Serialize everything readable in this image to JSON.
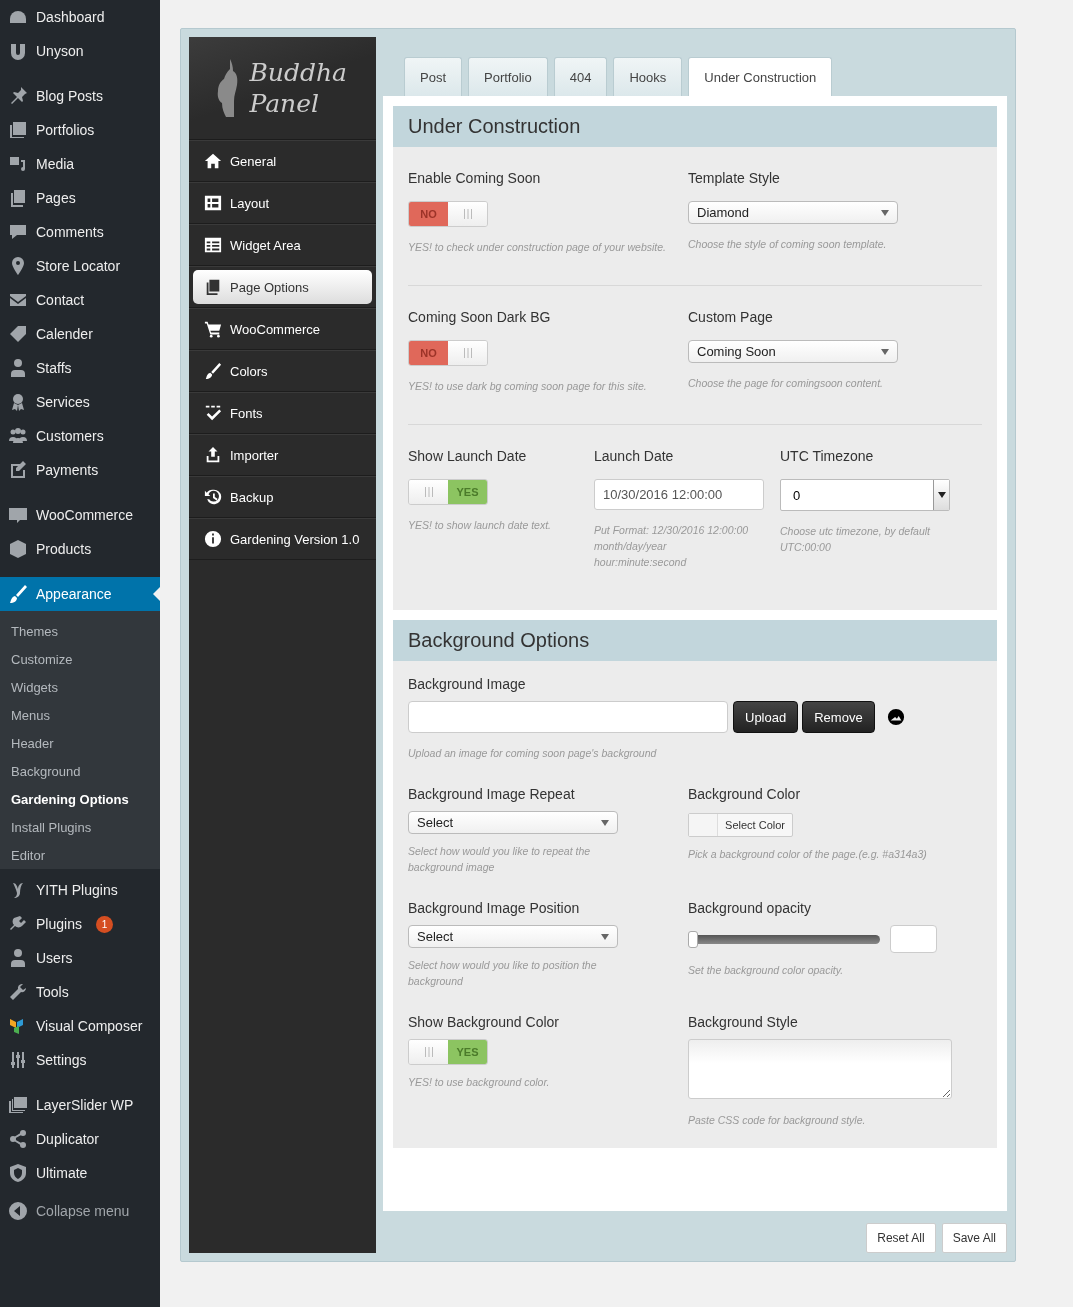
{
  "admin_menu": {
    "groups": [
      [
        {
          "label": "Dashboard",
          "selected": false
        },
        {
          "label": "Unyson",
          "selected": false
        }
      ],
      [
        {
          "label": "Blog Posts",
          "selected": false
        },
        {
          "label": "Portfolios",
          "selected": false
        },
        {
          "label": "Media",
          "selected": false
        },
        {
          "label": "Pages",
          "selected": false
        },
        {
          "label": "Comments",
          "selected": false
        },
        {
          "label": "Store Locator",
          "selected": false
        },
        {
          "label": "Contact",
          "selected": false
        },
        {
          "label": "Calender",
          "selected": false
        },
        {
          "label": "Staffs",
          "selected": false
        },
        {
          "label": "Services",
          "selected": false
        },
        {
          "label": "Customers",
          "selected": false
        },
        {
          "label": "Payments",
          "selected": false
        }
      ],
      [
        {
          "label": "WooCommerce",
          "selected": false
        },
        {
          "label": "Products",
          "selected": false
        }
      ],
      [
        {
          "label": "Appearance",
          "selected": true,
          "children": [
            {
              "label": "Themes",
              "selected": false
            },
            {
              "label": "Customize",
              "selected": false
            },
            {
              "label": "Widgets",
              "selected": false
            },
            {
              "label": "Menus",
              "selected": false
            },
            {
              "label": "Header",
              "selected": false
            },
            {
              "label": "Background",
              "selected": false
            },
            {
              "label": "Gardening Options",
              "selected": true
            },
            {
              "label": "Install Plugins",
              "selected": false
            },
            {
              "label": "Editor",
              "selected": false
            }
          ]
        }
      ],
      [
        {
          "label": "YITH Plugins",
          "selected": false
        },
        {
          "label": "Plugins",
          "selected": false,
          "badge": "1"
        },
        {
          "label": "Users",
          "selected": false
        },
        {
          "label": "Tools",
          "selected": false
        },
        {
          "label": "Visual Composer",
          "selected": false
        },
        {
          "label": "Settings",
          "selected": false
        }
      ],
      [
        {
          "label": "LayerSlider WP",
          "selected": false
        },
        {
          "label": "Duplicator",
          "selected": false
        },
        {
          "label": "Ultimate",
          "selected": false
        }
      ]
    ],
    "collapse": "Collapse menu"
  },
  "panel": {
    "logo": "Buddha Panel",
    "nav": [
      {
        "label": "General",
        "selected": false
      },
      {
        "label": "Layout",
        "selected": false
      },
      {
        "label": "Widget Area",
        "selected": false
      },
      {
        "label": "Page Options",
        "selected": true
      },
      {
        "label": "WooCommerce",
        "selected": false
      },
      {
        "label": "Colors",
        "selected": false
      },
      {
        "label": "Fonts",
        "selected": false
      },
      {
        "label": "Importer",
        "selected": false
      },
      {
        "label": "Backup",
        "selected": false
      },
      {
        "label": "Gardening Version 1.0",
        "selected": false
      }
    ]
  },
  "tabs": [
    {
      "label": "Post",
      "selected": false
    },
    {
      "label": "Portfolio",
      "selected": false
    },
    {
      "label": "404",
      "selected": false
    },
    {
      "label": "Hooks",
      "selected": false
    },
    {
      "label": "Under Construction",
      "selected": true
    }
  ],
  "sections": [
    {
      "title": "Under Construction",
      "divided": true,
      "rows": [
        [
          {
            "kind": "toggle",
            "label": "Enable Coming Soon",
            "on": false,
            "text": "NO",
            "help": "YES! to check under construction page of your website."
          },
          {
            "kind": "select",
            "label": "Template Style",
            "value": "Diamond",
            "help": "Choose the style of coming soon template."
          }
        ],
        [
          {
            "kind": "toggle",
            "label": "Coming Soon Dark BG",
            "on": false,
            "text": "NO",
            "help": "YES! to use dark bg coming soon page for this site."
          },
          {
            "kind": "select",
            "label": "Custom Page",
            "value": "Coming Soon",
            "help": "Choose the page for comingsoon content."
          }
        ],
        [
          {
            "kind": "toggle",
            "label": "Show Launch Date",
            "on": true,
            "text": "YES",
            "help": "YES! to show launch date text."
          },
          {
            "kind": "text",
            "label": "Launch Date",
            "value": "10/30/2016 12:00:00",
            "help": "Put Format: 12/30/2016 12:00:00\nmonth/day/year\nhour:minute:second"
          },
          {
            "kind": "combo",
            "label": "UTC Timezone",
            "value": "0",
            "help": "Choose utc timezone, by default UTC:00:00"
          }
        ]
      ]
    },
    {
      "title": "Background Options",
      "divided": false,
      "rows": [
        [
          {
            "kind": "upload",
            "label": "Background Image",
            "buttons": [
              "Upload",
              "Remove"
            ],
            "help": "Upload an image for coming soon page's background"
          }
        ],
        [
          {
            "kind": "select",
            "label": "Background Image Repeat",
            "value": "Select",
            "help": "Select how would you like to repeat the background image"
          },
          {
            "kind": "color",
            "label": "Background Color",
            "button": "Select Color",
            "help": "Pick a background color of the page.(e.g. #a314a3)"
          }
        ],
        [
          {
            "kind": "select",
            "label": "Background Image Position",
            "value": "Select",
            "help": "Select how would you like to position the background"
          },
          {
            "kind": "slider",
            "label": "Background opacity",
            "level": 0,
            "help": "Set the background color opacity."
          }
        ],
        [
          {
            "kind": "toggle",
            "label": "Show Background Color",
            "on": true,
            "text": "YES",
            "help": "YES! to use background color."
          },
          {
            "kind": "textarea",
            "label": "Background Style",
            "help": "Paste CSS code for background style."
          }
        ]
      ]
    }
  ],
  "actions": [
    "Reset All",
    "Save All"
  ]
}
